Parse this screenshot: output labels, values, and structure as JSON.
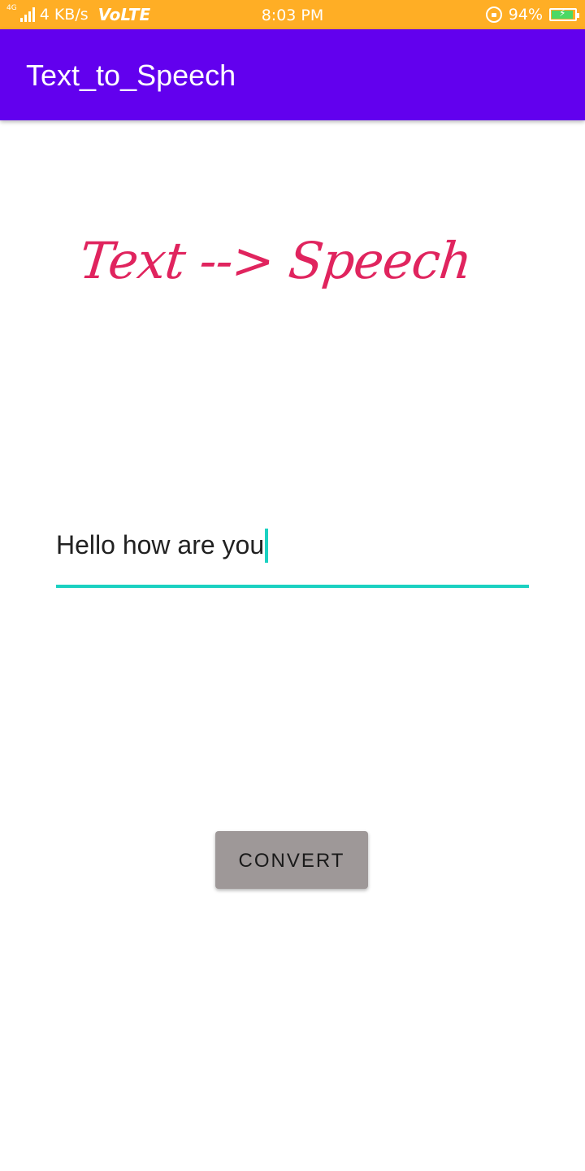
{
  "status_bar": {
    "network_type": "4G",
    "speed": "4 KB/s",
    "volte": "VoLTE",
    "time": "8:03 PM",
    "battery_percent": "94%",
    "battery_level": 0.94,
    "icons": [
      "signal-icon",
      "rotation-lock-icon",
      "battery-charging-icon"
    ],
    "background_color": "#ffae25"
  },
  "app_bar": {
    "title": "Text_to_Speech",
    "background_color": "#6200ee"
  },
  "main": {
    "heading": "Text --> Speech",
    "heading_color": "#e0245e",
    "input": {
      "value": "Hello how are you",
      "accent_color": "#1bd1c1"
    },
    "convert_button": {
      "label": "CONVERT",
      "background_color": "#9e9898"
    }
  }
}
